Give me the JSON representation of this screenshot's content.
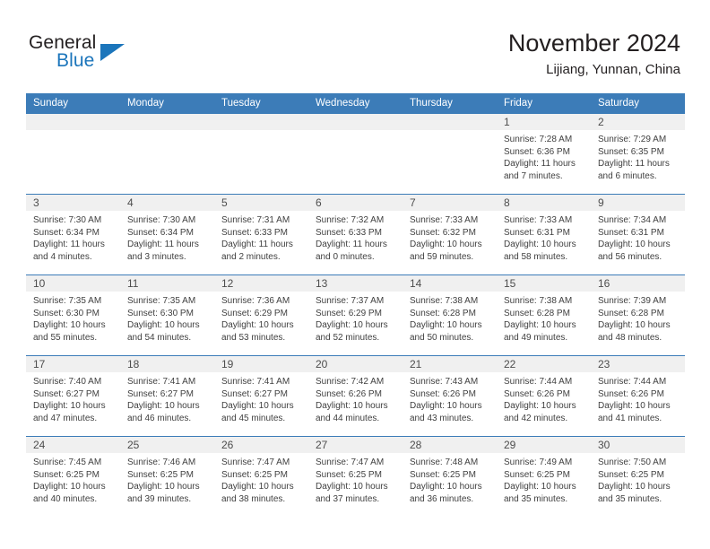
{
  "brand": {
    "name_top": "General",
    "name_bottom": "Blue",
    "triangle_icon": "triangle-icon",
    "color_dark": "#231f20",
    "color_blue": "#1b75bb"
  },
  "header": {
    "title": "November 2024",
    "subtitle": "Lijiang, Yunnan, China"
  },
  "theme": {
    "header_row_bg": "#3c7cb8",
    "day_strip_bg": "#f0f0f0",
    "cell_border": "#3c7cb8",
    "text": "#404040"
  },
  "calendar": {
    "weekdays": [
      "Sunday",
      "Monday",
      "Tuesday",
      "Wednesday",
      "Thursday",
      "Friday",
      "Saturday"
    ],
    "weeks": [
      [
        {
          "day": "",
          "lines": []
        },
        {
          "day": "",
          "lines": []
        },
        {
          "day": "",
          "lines": []
        },
        {
          "day": "",
          "lines": []
        },
        {
          "day": "",
          "lines": []
        },
        {
          "day": "1",
          "lines": [
            "Sunrise: 7:28 AM",
            "Sunset: 6:36 PM",
            "Daylight: 11 hours",
            "and 7 minutes."
          ]
        },
        {
          "day": "2",
          "lines": [
            "Sunrise: 7:29 AM",
            "Sunset: 6:35 PM",
            "Daylight: 11 hours",
            "and 6 minutes."
          ]
        }
      ],
      [
        {
          "day": "3",
          "lines": [
            "Sunrise: 7:30 AM",
            "Sunset: 6:34 PM",
            "Daylight: 11 hours",
            "and 4 minutes."
          ]
        },
        {
          "day": "4",
          "lines": [
            "Sunrise: 7:30 AM",
            "Sunset: 6:34 PM",
            "Daylight: 11 hours",
            "and 3 minutes."
          ]
        },
        {
          "day": "5",
          "lines": [
            "Sunrise: 7:31 AM",
            "Sunset: 6:33 PM",
            "Daylight: 11 hours",
            "and 2 minutes."
          ]
        },
        {
          "day": "6",
          "lines": [
            "Sunrise: 7:32 AM",
            "Sunset: 6:33 PM",
            "Daylight: 11 hours",
            "and 0 minutes."
          ]
        },
        {
          "day": "7",
          "lines": [
            "Sunrise: 7:33 AM",
            "Sunset: 6:32 PM",
            "Daylight: 10 hours",
            "and 59 minutes."
          ]
        },
        {
          "day": "8",
          "lines": [
            "Sunrise: 7:33 AM",
            "Sunset: 6:31 PM",
            "Daylight: 10 hours",
            "and 58 minutes."
          ]
        },
        {
          "day": "9",
          "lines": [
            "Sunrise: 7:34 AM",
            "Sunset: 6:31 PM",
            "Daylight: 10 hours",
            "and 56 minutes."
          ]
        }
      ],
      [
        {
          "day": "10",
          "lines": [
            "Sunrise: 7:35 AM",
            "Sunset: 6:30 PM",
            "Daylight: 10 hours",
            "and 55 minutes."
          ]
        },
        {
          "day": "11",
          "lines": [
            "Sunrise: 7:35 AM",
            "Sunset: 6:30 PM",
            "Daylight: 10 hours",
            "and 54 minutes."
          ]
        },
        {
          "day": "12",
          "lines": [
            "Sunrise: 7:36 AM",
            "Sunset: 6:29 PM",
            "Daylight: 10 hours",
            "and 53 minutes."
          ]
        },
        {
          "day": "13",
          "lines": [
            "Sunrise: 7:37 AM",
            "Sunset: 6:29 PM",
            "Daylight: 10 hours",
            "and 52 minutes."
          ]
        },
        {
          "day": "14",
          "lines": [
            "Sunrise: 7:38 AM",
            "Sunset: 6:28 PM",
            "Daylight: 10 hours",
            "and 50 minutes."
          ]
        },
        {
          "day": "15",
          "lines": [
            "Sunrise: 7:38 AM",
            "Sunset: 6:28 PM",
            "Daylight: 10 hours",
            "and 49 minutes."
          ]
        },
        {
          "day": "16",
          "lines": [
            "Sunrise: 7:39 AM",
            "Sunset: 6:28 PM",
            "Daylight: 10 hours",
            "and 48 minutes."
          ]
        }
      ],
      [
        {
          "day": "17",
          "lines": [
            "Sunrise: 7:40 AM",
            "Sunset: 6:27 PM",
            "Daylight: 10 hours",
            "and 47 minutes."
          ]
        },
        {
          "day": "18",
          "lines": [
            "Sunrise: 7:41 AM",
            "Sunset: 6:27 PM",
            "Daylight: 10 hours",
            "and 46 minutes."
          ]
        },
        {
          "day": "19",
          "lines": [
            "Sunrise: 7:41 AM",
            "Sunset: 6:27 PM",
            "Daylight: 10 hours",
            "and 45 minutes."
          ]
        },
        {
          "day": "20",
          "lines": [
            "Sunrise: 7:42 AM",
            "Sunset: 6:26 PM",
            "Daylight: 10 hours",
            "and 44 minutes."
          ]
        },
        {
          "day": "21",
          "lines": [
            "Sunrise: 7:43 AM",
            "Sunset: 6:26 PM",
            "Daylight: 10 hours",
            "and 43 minutes."
          ]
        },
        {
          "day": "22",
          "lines": [
            "Sunrise: 7:44 AM",
            "Sunset: 6:26 PM",
            "Daylight: 10 hours",
            "and 42 minutes."
          ]
        },
        {
          "day": "23",
          "lines": [
            "Sunrise: 7:44 AM",
            "Sunset: 6:26 PM",
            "Daylight: 10 hours",
            "and 41 minutes."
          ]
        }
      ],
      [
        {
          "day": "24",
          "lines": [
            "Sunrise: 7:45 AM",
            "Sunset: 6:25 PM",
            "Daylight: 10 hours",
            "and 40 minutes."
          ]
        },
        {
          "day": "25",
          "lines": [
            "Sunrise: 7:46 AM",
            "Sunset: 6:25 PM",
            "Daylight: 10 hours",
            "and 39 minutes."
          ]
        },
        {
          "day": "26",
          "lines": [
            "Sunrise: 7:47 AM",
            "Sunset: 6:25 PM",
            "Daylight: 10 hours",
            "and 38 minutes."
          ]
        },
        {
          "day": "27",
          "lines": [
            "Sunrise: 7:47 AM",
            "Sunset: 6:25 PM",
            "Daylight: 10 hours",
            "and 37 minutes."
          ]
        },
        {
          "day": "28",
          "lines": [
            "Sunrise: 7:48 AM",
            "Sunset: 6:25 PM",
            "Daylight: 10 hours",
            "and 36 minutes."
          ]
        },
        {
          "day": "29",
          "lines": [
            "Sunrise: 7:49 AM",
            "Sunset: 6:25 PM",
            "Daylight: 10 hours",
            "and 35 minutes."
          ]
        },
        {
          "day": "30",
          "lines": [
            "Sunrise: 7:50 AM",
            "Sunset: 6:25 PM",
            "Daylight: 10 hours",
            "and 35 minutes."
          ]
        }
      ]
    ]
  }
}
